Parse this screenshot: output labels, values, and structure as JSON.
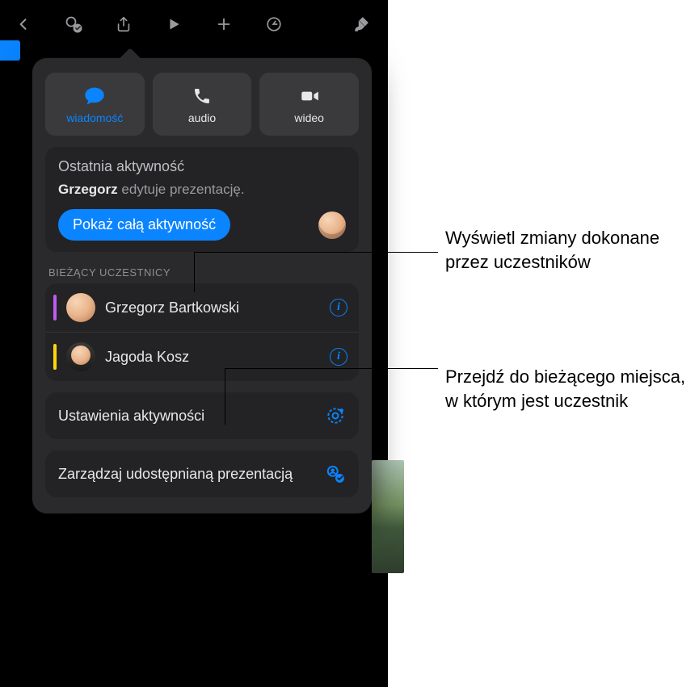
{
  "contact": {
    "message": "wiadomość",
    "audio": "audio",
    "video": "wideo"
  },
  "activity": {
    "heading": "Ostatnia aktywność",
    "actor": "Grzegorz",
    "text": " edytuje prezentację.",
    "show_all": "Pokaż całą aktywność"
  },
  "participants": {
    "heading": "BIEŻĄCY UCZESTNICY",
    "list": [
      {
        "name": "Grzegorz Bartkowski",
        "color": "#bf5af2"
      },
      {
        "name": "Jagoda Kosz",
        "color": "#ffd60a"
      }
    ]
  },
  "rows": {
    "activity_settings": "Ustawienia aktywności",
    "manage_share": "Zarządzaj udostępnianą prezentacją"
  },
  "callouts": {
    "c1": "Wyświetl zmiany dokonane przez uczestników",
    "c2": "Przejdź do bieżącego miejsca, w którym jest uczestnik"
  }
}
